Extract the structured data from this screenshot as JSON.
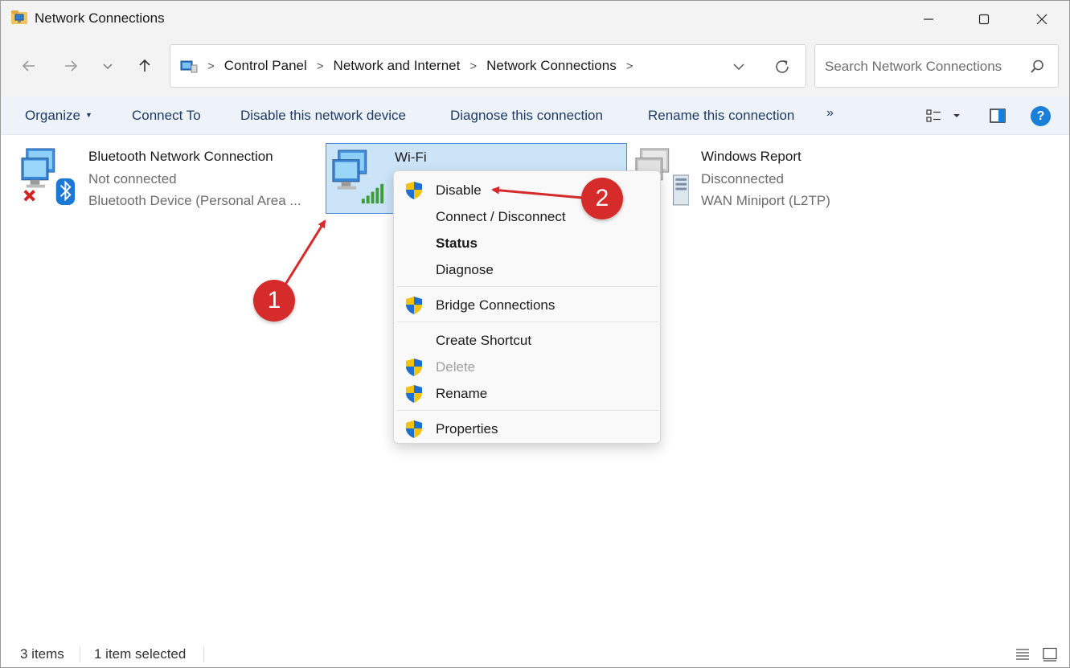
{
  "window": {
    "title": "Network Connections"
  },
  "address": {
    "crumbs": [
      "Control Panel",
      "Network and Internet",
      "Network Connections"
    ]
  },
  "search": {
    "placeholder": "Search Network Connections"
  },
  "commands": {
    "organize": "Organize",
    "connect_to": "Connect To",
    "disable_device": "Disable this network device",
    "diagnose": "Diagnose this connection",
    "rename": "Rename this connection",
    "more": "»",
    "help": "?"
  },
  "items": [
    {
      "name": "Bluetooth Network Connection",
      "status": "Not connected",
      "device": "Bluetooth Device (Personal Area ..."
    },
    {
      "name": "Wi-Fi"
    },
    {
      "name": "Windows Report",
      "status": "Disconnected",
      "device": "WAN Miniport (L2TP)"
    }
  ],
  "context_menu": {
    "items": [
      {
        "label": "Disable",
        "shield": true
      },
      {
        "label": "Connect / Disconnect",
        "shield": false
      },
      {
        "label": "Status",
        "shield": false,
        "bold": true
      },
      {
        "label": "Diagnose",
        "shield": false
      },
      {
        "label": "Bridge Connections",
        "shield": true
      },
      {
        "label": "Create Shortcut",
        "shield": false
      },
      {
        "label": "Delete",
        "shield": true,
        "disabled": true
      },
      {
        "label": "Rename",
        "shield": true
      },
      {
        "label": "Properties",
        "shield": true
      }
    ]
  },
  "annotations": {
    "step1": "1",
    "step2": "2",
    "color": "#d62b2b"
  },
  "status": {
    "count": "3 items",
    "selection": "1 item selected"
  }
}
